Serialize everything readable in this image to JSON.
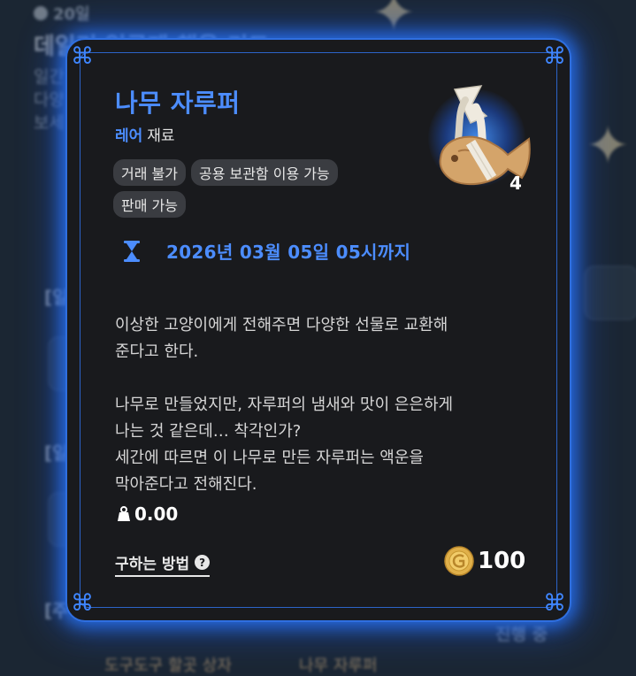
{
  "background": {
    "days_badge": "20일",
    "title": "데일리 일급제 책을 키드",
    "lines": [
      "일간",
      "다양",
      "보세"
    ],
    "brackets": [
      "[일",
      "[일",
      "[주"
    ],
    "status": "진행 중",
    "bottom_items": [
      "도구도구 할곳 상자",
      "나무 자루퍼"
    ]
  },
  "item": {
    "name": "나무 자루퍼",
    "rarity": "레어",
    "category": "재료",
    "tags": [
      "거래 불가",
      "공용 보관함 이용 가능",
      "판매 가능"
    ],
    "count": "4",
    "expiry": "2026년 03월 05일 05시까지",
    "description": "이상한 고양이에게 전해주면 다양한 선물로 교환해\n준다고 한다.\n\n나무로 만들었지만, 자루퍼의 냄새와 맛이 은은하게\n나는 것 같은데… 착각인가?\n세간에 따르면 이 나무로 만든 자루퍼는 액운을\n막아준다고 전해진다.",
    "weight": "0.00",
    "how_to_get": "구하는 방법",
    "price": "100"
  },
  "icons": {
    "item": "wooden-fish-icon",
    "expiry": "hourglass-icon",
    "weight": "weight-icon",
    "help": "question-icon",
    "currency": "gold-coin-icon"
  },
  "colors": {
    "accent_blue": "#4c8dff",
    "frame_blue": "#2f6fe0",
    "modal_bg": "#191a1d",
    "tag_bg": "#3a3c41",
    "coin_gold": "#e0b04a"
  }
}
